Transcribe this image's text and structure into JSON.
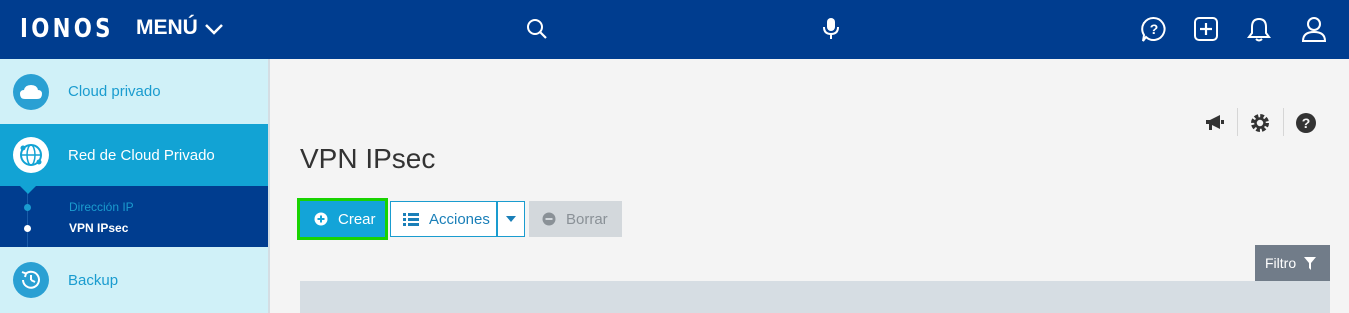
{
  "topbar": {
    "logo": "IONOS",
    "menu_label": "MENÚ",
    "icons": [
      "search-icon",
      "microphone-icon",
      "help-chat-icon",
      "add-icon",
      "bell-icon",
      "user-icon"
    ]
  },
  "sidebar": {
    "items": [
      {
        "label": "Cloud privado",
        "icon": "cloud-icon"
      },
      {
        "label": "Red de Cloud Privado",
        "icon": "network-globe-icon"
      },
      {
        "label": "Backup",
        "icon": "backup-clock-icon"
      }
    ],
    "subitems": [
      {
        "label": "Dirección IP"
      },
      {
        "label": "VPN IPsec"
      }
    ]
  },
  "main": {
    "title": "VPN IPsec",
    "utility_icons": [
      "megaphone-icon",
      "gear-icon",
      "question-icon"
    ],
    "buttons": {
      "crear": "Crear",
      "acciones": "Acciones",
      "borrar": "Borrar"
    },
    "filter_label": "Filtro"
  },
  "colors": {
    "topbar": "#003d8f",
    "accent": "#13a4d8",
    "highlight": "#19d300",
    "sidebar_bg": "#d0f1f8"
  }
}
